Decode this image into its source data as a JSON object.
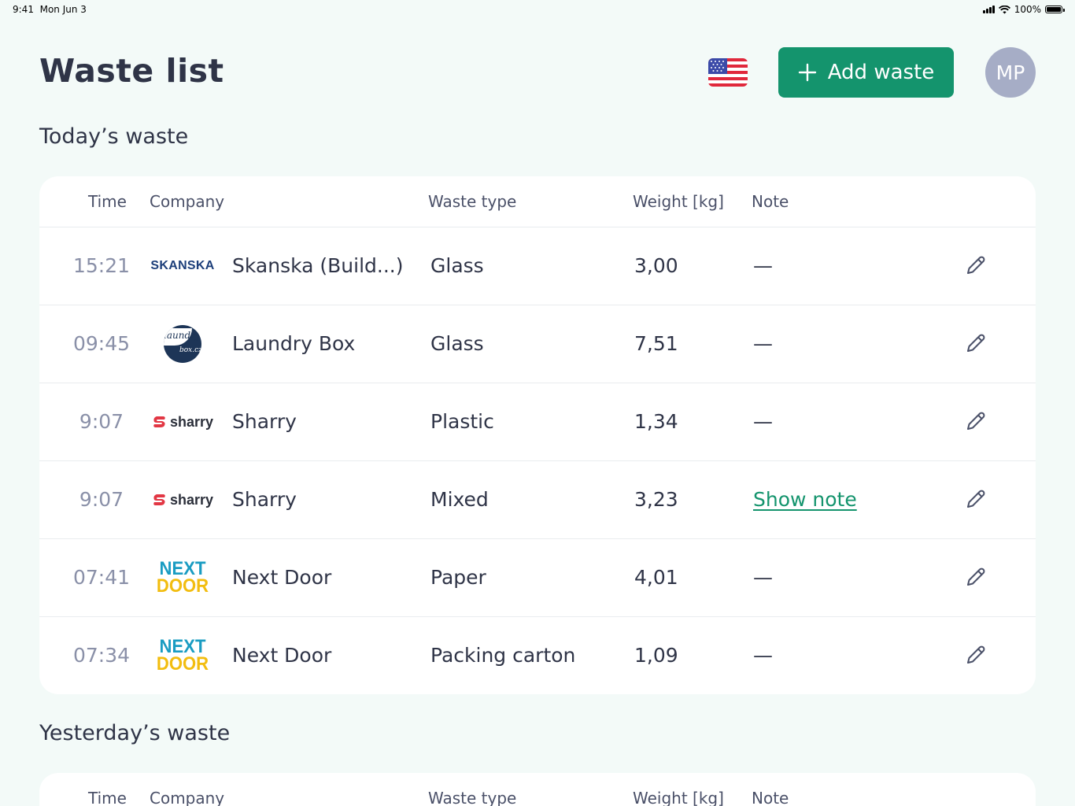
{
  "status_bar": {
    "time": "9:41",
    "date": "Mon Jun 3",
    "battery": "100%"
  },
  "header": {
    "title": "Waste list",
    "language_icon": "us-flag-icon",
    "add_button_label": "Add waste",
    "avatar_initials": "MP"
  },
  "colors": {
    "accent": "#14946d",
    "background": "#f3faf8",
    "avatar": "#a6adc6",
    "text": "#2f3447"
  },
  "columns": [
    "Time",
    "Company",
    "Waste type",
    "Weight [kg]",
    "Note"
  ],
  "today": {
    "title": "Today’s waste",
    "rows": [
      {
        "time": "15:21",
        "logo": "skanska-logo",
        "logo_text": "SKANSKA",
        "company": "Skanska (Build...)",
        "type": "Glass",
        "weight": "3,00",
        "note": "—"
      },
      {
        "time": "09:45",
        "logo": "laundry-box-logo",
        "logo_text": "laundry box.cz",
        "company": "Laundry Box",
        "type": "Glass",
        "weight": "7,51",
        "note": "—"
      },
      {
        "time": "9:07",
        "logo": "sharry-logo",
        "logo_text": "sharry",
        "company": "Sharry",
        "type": "Plastic",
        "weight": "1,34",
        "note": "—"
      },
      {
        "time": "9:07",
        "logo": "sharry-logo",
        "logo_text": "sharry",
        "company": "Sharry",
        "type": "Mixed",
        "weight": "3,23",
        "note": "Show note"
      },
      {
        "time": "07:41",
        "logo": "next-door-logo",
        "logo_text": "NEXT DOOR",
        "company": "Next Door",
        "type": "Paper",
        "weight": "4,01",
        "note": "—"
      },
      {
        "time": "07:34",
        "logo": "next-door-logo",
        "logo_text": "NEXT DOOR",
        "company": "Next Door",
        "type": "Packing carton",
        "weight": "1,09",
        "note": "—"
      }
    ]
  },
  "yesterday": {
    "title": "Yesterday’s waste"
  }
}
